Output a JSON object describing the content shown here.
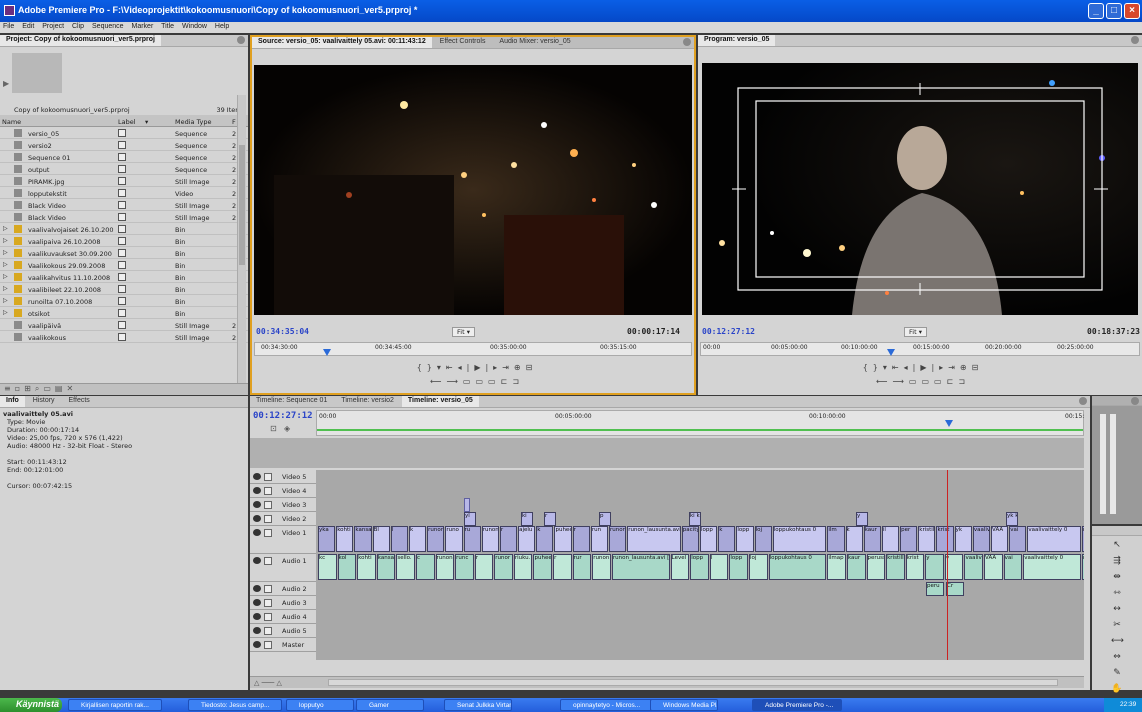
{
  "window": {
    "title": "Adobe Premiere Pro - F:\\Videoprojektit\\kokoomusnuori\\Copy of kokoomusnuori_ver5.prproj *"
  },
  "menu": [
    "File",
    "Edit",
    "Project",
    "Clip",
    "Sequence",
    "Marker",
    "Title",
    "Window",
    "Help"
  ],
  "project": {
    "tab": "Project: Copy of kokoomusnuori_ver5.prproj",
    "file": "Copy of kokoomusnuori_ver5.prproj",
    "count": "39 Items",
    "cols": {
      "name": "Name",
      "label": "Label",
      "media": "Media Type",
      "f": "F"
    },
    "items": [
      {
        "name": "versio_05",
        "type": "Sequence",
        "n": "2",
        "icon": "sequence"
      },
      {
        "name": "versio2",
        "type": "Sequence",
        "n": "2",
        "icon": "sequence"
      },
      {
        "name": "Sequence 01",
        "type": "Sequence",
        "n": "2",
        "icon": "sequence"
      },
      {
        "name": "output",
        "type": "Sequence",
        "n": "2",
        "icon": "sequence"
      },
      {
        "name": "PIRAMK.jpg",
        "type": "Still Image",
        "n": "2",
        "icon": "image"
      },
      {
        "name": "lopputekstit",
        "type": "Video",
        "n": "2",
        "icon": "video"
      },
      {
        "name": "Black Video",
        "type": "Still Image",
        "n": "2",
        "icon": "image"
      },
      {
        "name": "Black Video",
        "type": "Still Image",
        "n": "2",
        "icon": "image"
      },
      {
        "name": "vaalivalvojaiset 26.10.200",
        "type": "Bin",
        "n": "",
        "icon": "bin"
      },
      {
        "name": "vaalipaiva 26.10.2008",
        "type": "Bin",
        "n": "",
        "icon": "bin"
      },
      {
        "name": "vaalikuvaukset 30.09.200",
        "type": "Bin",
        "n": "",
        "icon": "bin"
      },
      {
        "name": "Vaalikokous 29.09.2008",
        "type": "Bin",
        "n": "",
        "icon": "bin"
      },
      {
        "name": "vaalikahvitus 11.10.2008",
        "type": "Bin",
        "n": "",
        "icon": "bin"
      },
      {
        "name": "vaalibileet 22.10.2008",
        "type": "Bin",
        "n": "",
        "icon": "bin"
      },
      {
        "name": "runoilta 07.10.2008",
        "type": "Bin",
        "n": "",
        "icon": "bin"
      },
      {
        "name": "otsikot",
        "type": "Bin",
        "n": "",
        "icon": "bin"
      },
      {
        "name": "vaalipäivä",
        "type": "Still Image",
        "n": "2",
        "icon": "image"
      },
      {
        "name": "vaalikokous",
        "type": "Still Image",
        "n": "2",
        "icon": "image"
      }
    ]
  },
  "info": {
    "tabs": [
      "Info",
      "History",
      "Effects"
    ],
    "clip": "vaalivaittely 05.avi",
    "lines": [
      "Type: Movie",
      "Duration: 00:00:17:14",
      "Video: 25,00 fps, 720 x 576 (1,422)",
      "Audio: 48000 Hz - 32-bit Float - Stereo",
      "",
      "Start: 00:11:43:12",
      "End: 00:12:01:00",
      "",
      "Cursor: 00:07:42:15"
    ]
  },
  "source": {
    "tabs": [
      "Source: versio_05: vaalivaittely 05.avi: 00:11:43:12",
      "Effect Controls",
      "Audio Mixer: versio_05"
    ],
    "tc_current": "00:34:35:04",
    "tc_duration": "00:00:17:14",
    "fit": "Fit",
    "ruler": [
      "00:34:30:00",
      "00:34:45:00",
      "00:35:00:00",
      "00:35:15:00"
    ]
  },
  "program": {
    "tab": "Program: versio_05",
    "tc_current": "00:12:27:12",
    "tc_duration": "00:18:37:23",
    "fit": "Fit",
    "ruler": [
      "00:00",
      "00:05:00:00",
      "00:10:00:00",
      "00:15:00:00",
      "00:20:00:00",
      "00:25:00:00"
    ]
  },
  "timeline": {
    "tabs": [
      "Timeline: Sequence 01",
      "Timeline: versio2",
      "Timeline: versio_05"
    ],
    "tc": "00:12:27:12",
    "ruler": [
      "00:00",
      "00:05:00:00",
      "00:10:00:00",
      "00:15:"
    ],
    "tracks": [
      "Video 5",
      "Video 4",
      "Video 3",
      "Video 2",
      "Video 1",
      "Audio 1",
      "Audio 2",
      "Audio 3",
      "Audio 4",
      "Audio 5",
      "Master"
    ],
    "v2clips": [
      "yl",
      "ki",
      "r",
      "p",
      "ki ki",
      "y",
      "yk ki"
    ],
    "v1clips": [
      "yka",
      "kohti",
      "kansann",
      "Bl",
      "l",
      "k",
      "runonlausun",
      "runo",
      "ru",
      "runon",
      "r",
      "ajelu",
      "k",
      "puheen",
      "r",
      "run",
      "runon",
      "runon_lausunta.avi [V]",
      "pacity",
      "lopp",
      "k",
      "lopp",
      "loj",
      "loppukohtaus 0",
      "ilm",
      "k",
      "kaur",
      "il",
      "per",
      "kristillis",
      "krist",
      "yk",
      "vaalivai",
      "VAA",
      "vai",
      "vaalivaittely 0",
      "r",
      "sello.e",
      "yka_e",
      "ylu",
      "tietov",
      "tiet"
    ],
    "a1clips": [
      "kc",
      "kol",
      "kohti",
      "kansann",
      "sello.",
      "c",
      "runonlausun",
      "runc",
      "r",
      "runor",
      "riuku.",
      "puheen",
      "r",
      "rur",
      "runon",
      "runon_lausunta.avi [A]",
      "Level",
      "lopp",
      "l",
      "lopp",
      "loj",
      "loppukohtaus 0",
      "ilmap",
      "kaur",
      "peruss",
      "kristill",
      "krist",
      "y",
      "v",
      "vaalivai",
      "VAA",
      "vai",
      "vaalivaittely 0",
      "r",
      "sello.avi",
      "yka_e",
      "ylu",
      "tietov",
      "tiet"
    ],
    "a2clips": [
      "peru",
      "Cr"
    ]
  },
  "taskbar": {
    "start": "Käynnistä",
    "items": [
      "Kirjallisen raportin rak...",
      "Tiedosto: Jesus camp...",
      "lopputyo",
      "Gamer",
      "Senat Julkka Virtanen",
      "opinnaytetyo - Micros...",
      "Windows Media Player",
      "Adobe Premiere Pro -..."
    ],
    "time": "22:39"
  },
  "colors": {
    "source_border": "#e0a020",
    "playhead": "#cc2222",
    "titlebar": "#0a5fe6",
    "timecode": "#2a44c8"
  }
}
